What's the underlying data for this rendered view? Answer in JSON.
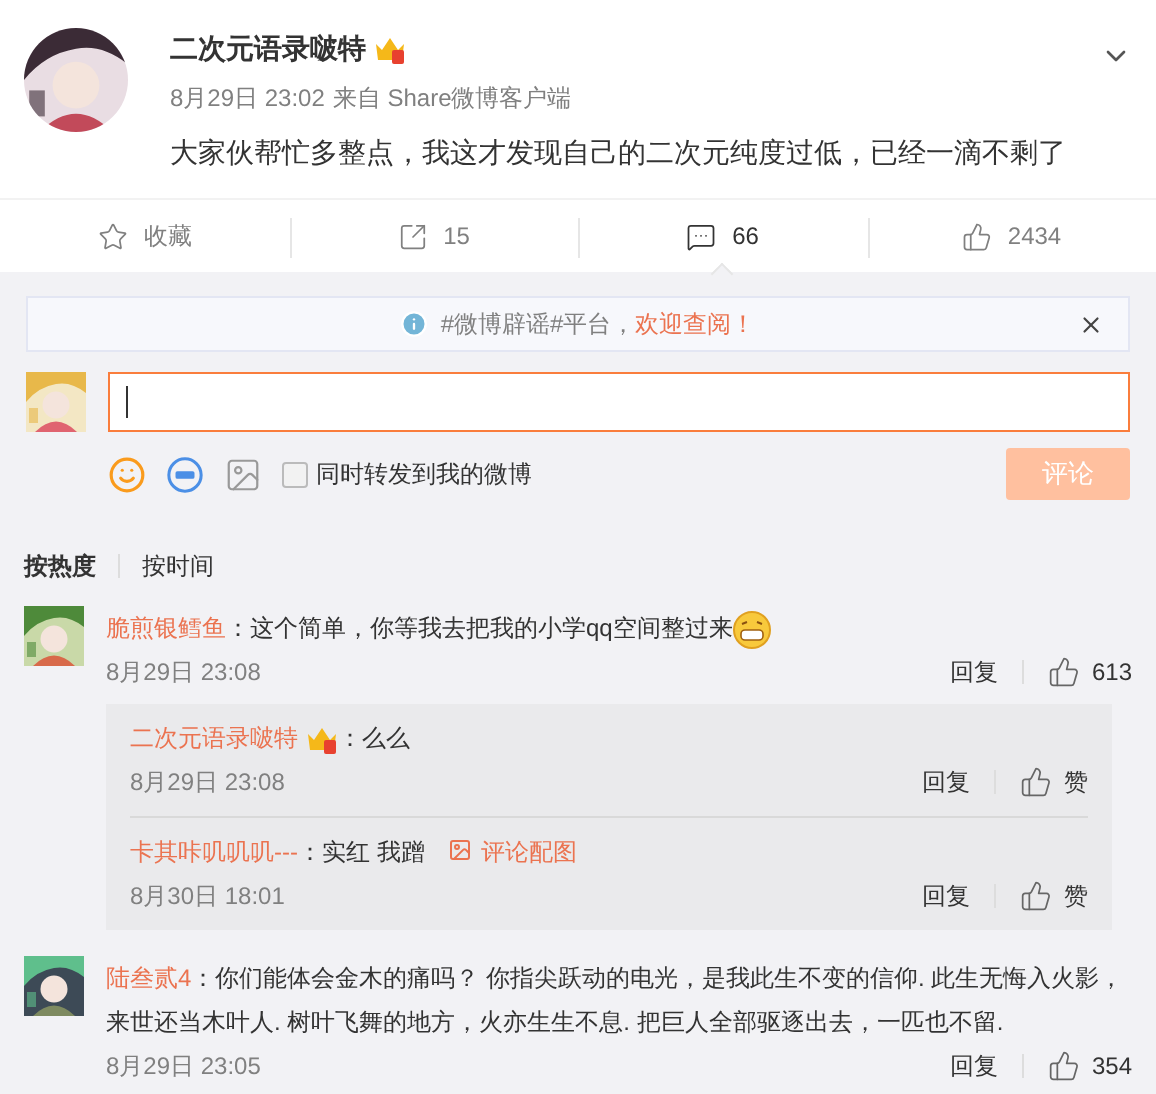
{
  "post": {
    "author": "二次元语录啵特",
    "crown": true,
    "time": "8月29日 23:02",
    "source": "来自 Share微博客户端",
    "text": "大家伙帮忙多整点，我这才发现自己的二次元纯度过低，已经一滴不剩了"
  },
  "actions": [
    {
      "kind": "star",
      "label": "收藏",
      "selected": false
    },
    {
      "kind": "share",
      "label": "15",
      "selected": false
    },
    {
      "kind": "comment",
      "label": "66",
      "selected": true
    },
    {
      "kind": "like",
      "label": "2434",
      "selected": false
    }
  ],
  "notice": {
    "text": "#微博辟谣#平台，",
    "link": "欢迎查阅！"
  },
  "composer": {
    "checkbox_label": "同时转发到我的微博",
    "checked": false,
    "submit": "评论",
    "disabled": true
  },
  "sort_tabs": [
    {
      "label": "按热度",
      "selected": true
    },
    {
      "label": "按时间",
      "selected": false
    }
  ],
  "comments": [
    {
      "user": "脆煎银鳕鱼",
      "crown": false,
      "text": "：这个简单，你等我去把我的小学qq空间整过来",
      "emoji": true,
      "time": "8月29日 23:08",
      "reply": "回复",
      "likes": "613",
      "replies": [
        {
          "user": "二次元语录啵特",
          "crown": true,
          "text": "：么么",
          "time": "8月29日 23:08",
          "reply": "回复",
          "likes": "赞"
        },
        {
          "user": "卡其咔叽叽叽---",
          "crown": false,
          "text": "：实红 我蹭",
          "attachment": "评论配图",
          "time": "8月30日 18:01",
          "reply": "回复",
          "likes": "赞"
        }
      ]
    },
    {
      "user": "陆叁贰4",
      "crown": false,
      "text": "：你们能体会金木的痛吗？ 你指尖跃动的电光，是我此生不变的信仰. 此生无悔入火影，来世还当木叶人. 树叶飞舞的地方，火亦生生不息. 把巨人全部驱逐出去，一匹也不留.",
      "emoji": false,
      "time": "8月29日 23:05",
      "reply": "回复",
      "likes": "354"
    }
  ]
}
